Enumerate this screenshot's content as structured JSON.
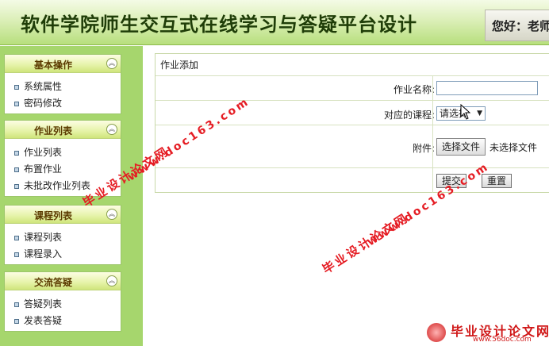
{
  "header": {
    "title": "软件学院师生交互式在线学习与答疑平台设计",
    "greeting": "您好：老师"
  },
  "sidebar": {
    "panels": [
      {
        "title": "基本操作",
        "items": [
          "系统属性",
          "密码修改"
        ]
      },
      {
        "title": "作业列表",
        "items": [
          "作业列表",
          "布置作业",
          "未批改作业列表"
        ]
      },
      {
        "title": "课程列表",
        "items": [
          "课程列表",
          "课程录入"
        ]
      },
      {
        "title": "交流答疑",
        "items": [
          "答疑列表",
          "发表答疑"
        ]
      }
    ],
    "collapse_icon": "double-chevron-up-icon"
  },
  "form": {
    "caption": "作业添加",
    "name_label": "作业名称:",
    "name_value": "",
    "course_label": "对应的课程:",
    "course_selected": "请选择",
    "attachment_label": "附件:",
    "file_button": "选择文件",
    "file_status": "未选择文件",
    "submit_label": "提交",
    "reset_label": "重置"
  },
  "watermarks": {
    "site_cn": "毕业设计论文网",
    "site_url": "www.doc163.com",
    "logo_url": "www.56doc.com"
  },
  "colors": {
    "sidebar_bg": "#a6d66d",
    "header_text": "#1f3d08",
    "watermark": "#e51c23"
  }
}
